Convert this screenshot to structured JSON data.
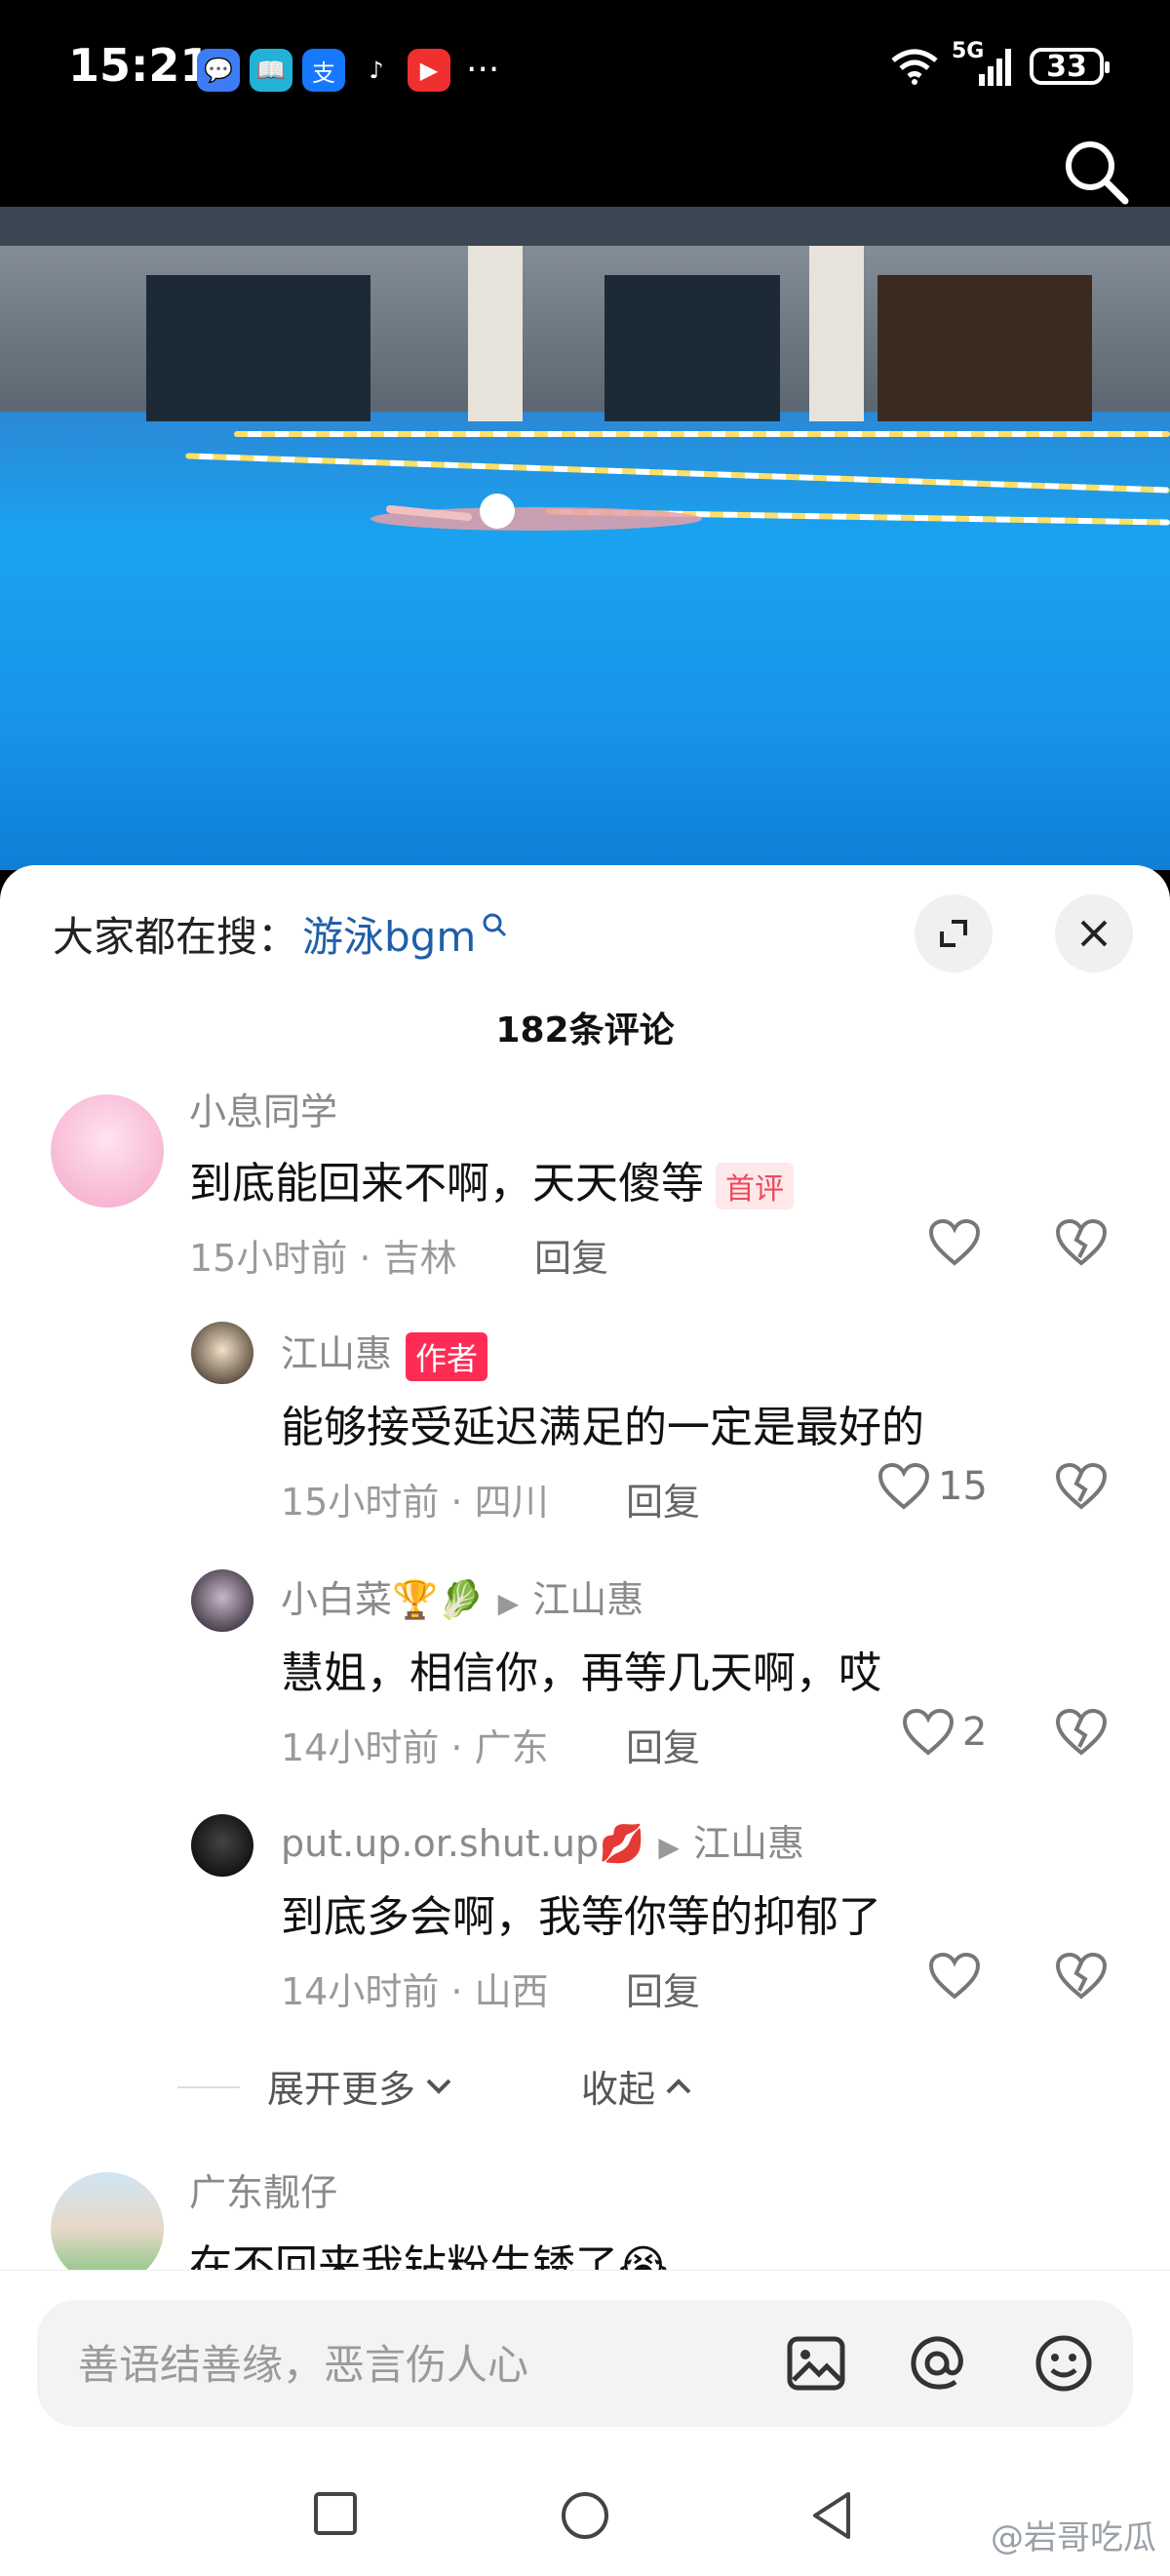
{
  "status": {
    "time": "15:21",
    "network": "5G",
    "battery": "33"
  },
  "trending": {
    "prefix": "大家都在搜：",
    "term": "游泳bgm"
  },
  "comments_count": "182条评论",
  "comments": [
    {
      "user": "小息同学",
      "text": "到底能回来不啊，天天傻等",
      "badge": "首评",
      "time": "15小时前 · 吉林",
      "reply": "回复",
      "likes": ""
    },
    {
      "user": "江山惠",
      "text": "能够接受延迟满足的一定是最好的",
      "badge": "作者",
      "time": "15小时前 · 四川",
      "reply": "回复",
      "likes": "15"
    },
    {
      "user": "小白菜🏆🥬",
      "reply_to": "江山惠",
      "text": "慧姐，相信你，再等几天啊，哎",
      "time": "14小时前 · 广东",
      "reply": "回复",
      "likes": "2"
    },
    {
      "user": "put.up.or.shut.up💋",
      "reply_to": "江山惠",
      "text": "到底多会啊，我等你等的抑郁了",
      "time": "14小时前 · 山西",
      "reply": "回复",
      "likes": ""
    },
    {
      "user": "广东靓仔",
      "text": "在不回来我钻粉生锈了😭"
    }
  ],
  "expand": {
    "more": "展开更多",
    "collapse": "收起"
  },
  "input": {
    "placeholder": "善语结善缘，恶言伤人心"
  },
  "watermark": "@岩哥吃瓜"
}
